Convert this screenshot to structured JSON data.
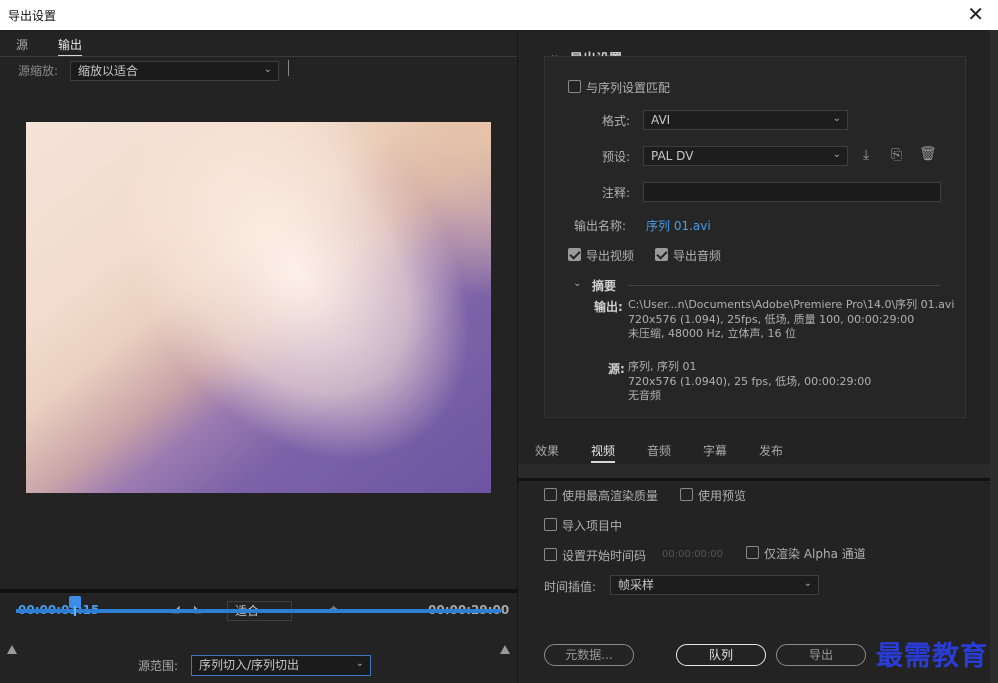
{
  "window": {
    "title": "导出设置",
    "close_glyph": "✕"
  },
  "left": {
    "tabs": [
      {
        "label": "源"
      },
      {
        "label": "输出"
      }
    ],
    "source_zoom_label": "源缩放:",
    "source_zoom_value": "缩放以适合",
    "timecode_current": "00:00:03:15",
    "timecode_total": "00:00:29:00",
    "fit_value": "适合",
    "range_label": "源范围:",
    "range_value": "序列切入/序列切出"
  },
  "export": {
    "section_title": "导出设置",
    "match_sequence_label": "与序列设置匹配",
    "match_sequence_checked": false,
    "format_label": "格式:",
    "format_value": "AVI",
    "preset_label": "预设:",
    "preset_value": "PAL DV",
    "comment_label": "注释:",
    "comment_value": "",
    "output_name_label": "输出名称:",
    "output_name_value": "序列 01.avi",
    "export_video_label": "导出视频",
    "export_video_checked": true,
    "export_audio_label": "导出音频",
    "export_audio_checked": true,
    "summary_title": "摘要",
    "summary_output_label": "输出:",
    "summary_output_lines": [
      "C:\\User...n\\Documents\\Adobe\\Premiere Pro\\14.0\\序列 01.avi",
      "720x576 (1.094), 25fps, 低场, 质量 100, 00:00:29:00",
      "未压缩, 48000 Hz, 立体声, 16 位"
    ],
    "summary_source_label": "源:",
    "summary_source_lines": [
      "序列, 序列 01",
      "720x576 (1.0940), 25 fps, 低场, 00:00:29:00",
      "无音频"
    ]
  },
  "bottom_tabs": [
    {
      "label": "效果"
    },
    {
      "label": "视频"
    },
    {
      "label": "音频"
    },
    {
      "label": "字幕"
    },
    {
      "label": "发布"
    }
  ],
  "options": {
    "max_render_label": "使用最高渲染质量",
    "use_preview_label": "使用预览",
    "import_project_label": "导入项目中",
    "set_start_tc_label": "设置开始时间码",
    "start_tc_value": "00:00:00:00",
    "alpha_only_label": "仅渲染 Alpha 通道",
    "interp_label": "时间插值:",
    "interp_value": "帧采样"
  },
  "buttons": {
    "metadata": "元数据...",
    "queue": "队列",
    "export": "导出"
  },
  "watermark": "最需教育",
  "colors": {
    "accent": "#4a9ce8",
    "track": "#2e7fd4",
    "background": "#232323"
  },
  "icons": [
    "close-icon",
    "chevron-down-icon",
    "save-preset-icon",
    "import-preset-icon",
    "delete-preset-icon",
    "mark-in-icon",
    "mark-out-icon",
    "crop-icon"
  ]
}
